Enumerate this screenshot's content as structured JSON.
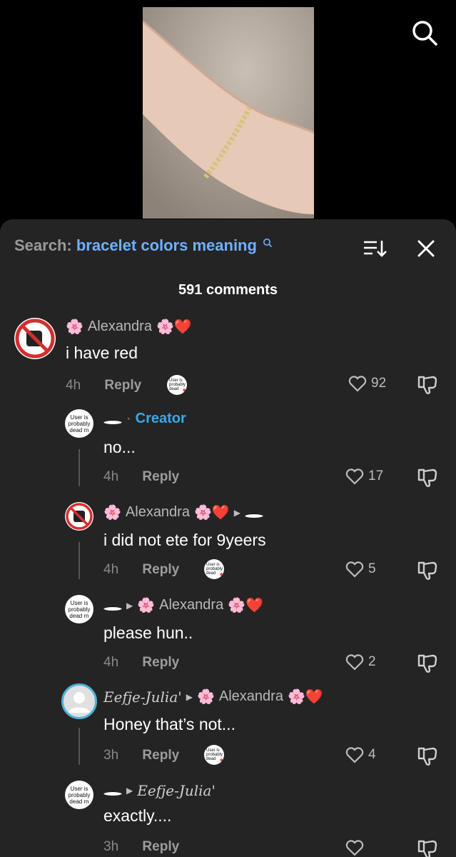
{
  "search": {
    "prefix": "Search:",
    "term": "bracelet colors meaning"
  },
  "comment_count": "591 comments",
  "comments": [
    {
      "name_prefix": "🌸",
      "name": "Alexandra",
      "name_suffix": "🌸❤️",
      "text": "i have red",
      "time": "4h",
      "reply": "Reply",
      "likes": "92",
      "avatar_icon": "no-fist-icon"
    },
    {
      "label": "Creator",
      "text": "no...",
      "time": "4h",
      "reply": "Reply",
      "likes": "17",
      "avatar_text": "User is probably dead rn"
    },
    {
      "name_prefix": "🌸",
      "name": "Alexandra",
      "name_suffix": "🌸❤️",
      "text": "i did not ete for 9yeers",
      "time": "4h",
      "reply": "Reply",
      "likes": "5",
      "avatar_icon": "no-fist-icon"
    },
    {
      "reply_to_prefix": "🌸",
      "reply_to": "Alexandra",
      "reply_to_suffix": "🌸❤️",
      "text": "please hun..",
      "time": "4h",
      "reply": "Reply",
      "likes": "2",
      "avatar_text": "User is probably dead rn"
    },
    {
      "name": "Eefje-Julia'",
      "reply_to_prefix": "🌸",
      "reply_to": "Alexandra",
      "reply_to_suffix": "🌸❤️",
      "text": "Honey that’s not...",
      "time": "3h",
      "reply": "Reply",
      "likes": "4"
    },
    {
      "reply_to": "Eefje-Julia'",
      "text": "exactly....",
      "time": "3h",
      "reply": "Reply",
      "avatar_text": "User is probably dead rn"
    }
  ],
  "liked_by_avatar_text": "User is probably dead",
  "colors": {
    "sheet": "#242424",
    "accent_search": "#6fb0ff",
    "creator": "#3ea7e6"
  }
}
